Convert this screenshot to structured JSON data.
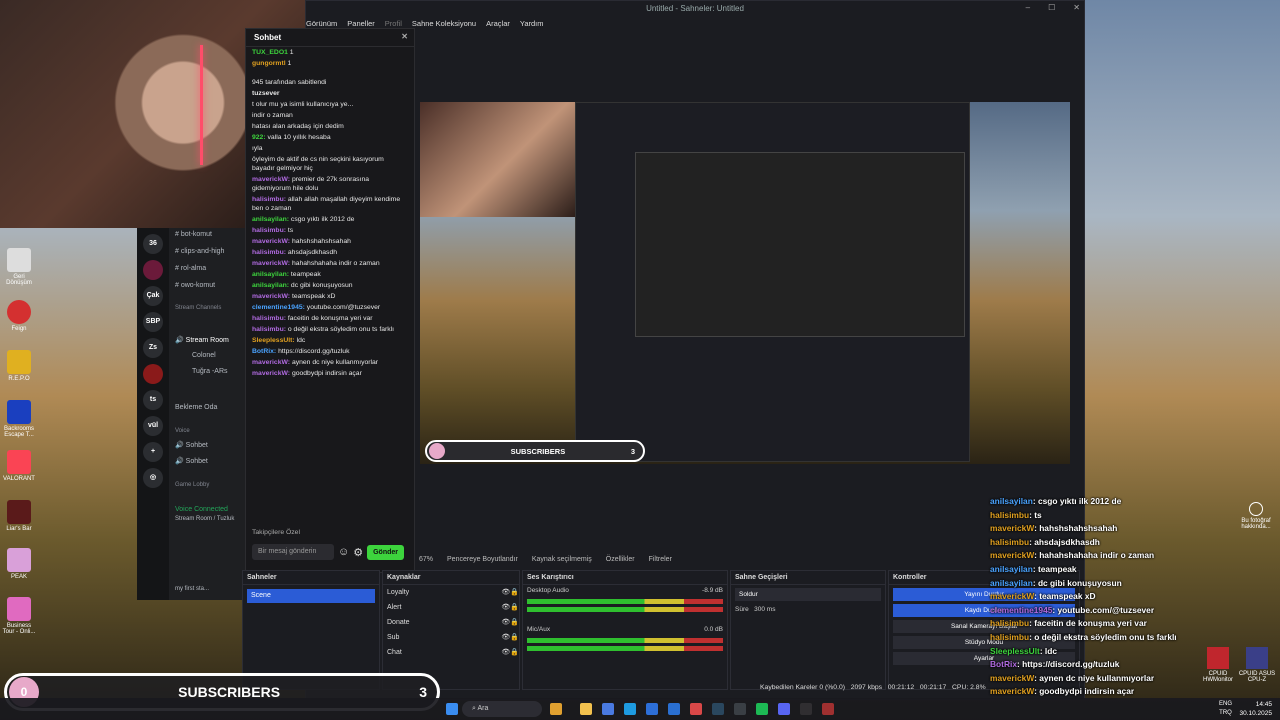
{
  "window": {
    "title": "Untitled - Sahneler: Untitled"
  },
  "menu": [
    "Görünüm",
    "Paneller",
    "Profil",
    "Sahne Koleksiyonu",
    "Araçlar",
    "Yardım"
  ],
  "chat": {
    "header": "Sohbet",
    "top_users": [
      {
        "name": "TUX_EDO1",
        "count": "1"
      },
      {
        "name": "gungormtl",
        "count": "1"
      }
    ],
    "pinned_by": "945 tarafından sabitlendi",
    "pinned_user": "tuzsever",
    "lines": [
      {
        "user": "",
        "text": "t olur mu ya isimli kullanıcıya ye..."
      },
      {
        "user": "",
        "text": "indir o zaman"
      },
      {
        "user": "",
        "text": "hatası alan arkadaş için dedim"
      },
      {
        "user": "922:",
        "text": "valla 10 yıllık hesaba"
      },
      {
        "user": "",
        "text": "ıyla"
      },
      {
        "user": "",
        "text": "öyleyim de aktif de cs nin seçkini kasıyorum bayadır gelmiyor hiç"
      },
      {
        "user": "maverickW:",
        "text": "premier de 27k sonrasına gidemiyorum hile dolu"
      },
      {
        "user": "halisimbu:",
        "text": "allah allah maşallah diyeyim kendime ben o zaman"
      },
      {
        "user": "anilsayilan:",
        "text": "csgo yıktı ilk 2012 de"
      },
      {
        "user": "halisimbu:",
        "text": "ts"
      },
      {
        "user": "maverickW:",
        "text": "hahshshahshsahah"
      },
      {
        "user": "halisimbu:",
        "text": "ahsdajsdkhasdh"
      },
      {
        "user": "maverickW:",
        "text": "hahahshahaha indir o zaman"
      },
      {
        "user": "anilsayilan:",
        "text": "teampeak"
      },
      {
        "user": "anilsayilan:",
        "text": "dc gibi konuşuyosun"
      },
      {
        "user": "maverickW:",
        "text": "teamspeak xD"
      },
      {
        "user": "clementine1945:",
        "text": "youtube.com/@tuzsever"
      },
      {
        "user": "halisimbu:",
        "text": "faceitin de konuşma yeri var"
      },
      {
        "user": "halisimbu:",
        "text": "o değil ekstra söyledim onu ts farklı"
      },
      {
        "user": "SleeplessUlt:",
        "text": "ldc"
      },
      {
        "user": "BotRix:",
        "text": "https://discord.gg/tuzluk"
      },
      {
        "user": "maverickW:",
        "text": "aynen dc niye kullanmıyorlar"
      },
      {
        "user": "maverickW:",
        "text": "goodbydpi indirsin açar"
      }
    ],
    "followers_only": "Takipçilere Özel",
    "input_placeholder": "Bir mesaj gönderin",
    "send_label": "Gönder"
  },
  "discord": {
    "servers": [
      "36",
      "Çak",
      "SBP",
      "Zs",
      "ts",
      "vül"
    ],
    "channels": [
      "bot-komut",
      "clips-and-high",
      "rol-alma",
      "owo-komut"
    ],
    "stream_cat": "Stream Channels",
    "stream_room": "Stream Room",
    "members": [
      "Colonel",
      "Tuğra -ARs"
    ],
    "bekleme": "Bekleme Oda",
    "voice_cat": "Voice",
    "voice": [
      "Sohbet",
      "Sohbet"
    ],
    "lobby_cat": "Game Lobby",
    "voice_connected": "Voice Connected",
    "voice_room": "Stream Room / Tuzluk",
    "user_status": "my first sta..."
  },
  "toolbar": {
    "zoom": "67%",
    "fit": "Pencereye Boyutlandır",
    "no_source": "Kaynak seçilmemiş",
    "properties": "Özellikler",
    "filters": "Filtreler"
  },
  "docks": {
    "scenes": {
      "title": "Sahneler",
      "items": [
        "Scene"
      ]
    },
    "sources": {
      "title": "Kaynaklar",
      "items": [
        "Loyalty",
        "Alert",
        "Donate",
        "Sub",
        "Chat"
      ]
    },
    "mixer": {
      "title": "Ses Karıştırıcı",
      "tracks": [
        {
          "name": "Desktop Audio",
          "db": "-8.9 dB"
        },
        {
          "name": "Mic/Aux",
          "db": "0.0 dB"
        }
      ]
    },
    "transitions": {
      "title": "Sahne Geçişleri",
      "type": "Soldur",
      "duration_label": "Süre",
      "duration": "300 ms"
    },
    "controls": {
      "title": "Kontroller",
      "buttons": [
        "Yayını Durdur",
        "Kaydı Durdur",
        "Sanal Kamerayı Başlat",
        "Stüdyo Modu",
        "Ayarlar"
      ]
    }
  },
  "status": {
    "dropped": "Kaybedilen Kareler 0 (%0.0)",
    "bitrate": "2097 kbps",
    "stream_time": "00:21:12",
    "rec_time": "00:21:17",
    "cpu": "CPU: 2.8%"
  },
  "overlay_chat": [
    {
      "user": "anilsayilan",
      "text": ": csgo yıktı ilk 2012 de"
    },
    {
      "user": "halisimbu",
      "text": ": ts"
    },
    {
      "user": "maverickW",
      "text": ": hahshshahshsahah"
    },
    {
      "user": "halisimbu",
      "text": ": ahsdajsdkhasdh"
    },
    {
      "user": "maverickW",
      "text": ": hahahshahaha indir o zaman"
    },
    {
      "user": "anilsayilan",
      "text": ": teampeak"
    },
    {
      "user": "anilsayilan",
      "text": ": dc gibi konuşuyosun"
    },
    {
      "user": "maverickW",
      "text": ": teamspeak xD"
    },
    {
      "user": "clementine1945",
      "text": ": youtube.com/@tuzsever"
    },
    {
      "user": "halisimbu",
      "text": ": faceitin de konuşma yeri var"
    },
    {
      "user": "halisimbu",
      "text": ": o değil ekstra söyledim onu ts farklı"
    },
    {
      "user": "SleeplessUlt",
      "text": ": ldc"
    },
    {
      "user": "BotRix",
      "text": ": https://discord.gg/tuzluk"
    },
    {
      "user": "maverickW",
      "text": ": aynen dc niye kullanmıyorlar"
    },
    {
      "user": "maverickW",
      "text": ": goodbydpi indirsin açar"
    }
  ],
  "subscribers": {
    "label": "SUBSCRIBERS",
    "left": "0",
    "count": "3",
    "mini_count": "3"
  },
  "desktop_icons": [
    "Geri Dönüşüm",
    "Feign",
    "R.E.P.O",
    "Backrooms Escape T...",
    "VALORANT",
    "Liar's Bar",
    "PEAK",
    "Business Tour - Onli..."
  ],
  "right_icons": {
    "about_photo": "Bu fotoğraf hakkında...",
    "cpuid": "CPUID HWMonitor",
    "cpuz": "CPUID ASUS CPU-Z"
  },
  "taskbar": {
    "search": "Ara",
    "lang": "ENG",
    "lang2": "TRQ",
    "time": "14:45",
    "date": "30.10.2025"
  },
  "colors": {
    "accent": "#2b5cd6",
    "green": "#3dd43d",
    "chat_bg": "#18181b"
  }
}
